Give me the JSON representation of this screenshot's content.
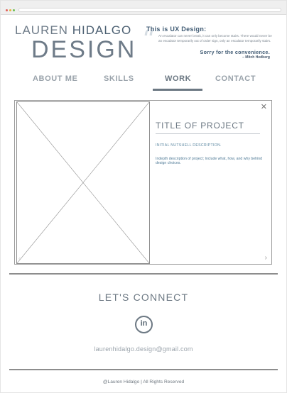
{
  "logo": {
    "first_name": "LAUREN",
    "last_name": "HIDALGO",
    "word": "DESIGN"
  },
  "quote": {
    "title": "This is UX Design:",
    "body": "An escalator can never break, it can only become stairs. There would never be an escalator temporarily out of order sign, only an escalator temporarily stairs.",
    "sorry": "Sorry for the convenience.",
    "author": "– Mitch Hedberg"
  },
  "nav": {
    "items": [
      {
        "label": "ABOUT ME"
      },
      {
        "label": "SKILLS"
      },
      {
        "label": "WORK"
      },
      {
        "label": "CONTACT"
      }
    ],
    "active": "WORK"
  },
  "project": {
    "title": "TITLE OF PROJECT",
    "nutshell": "INITIAL NUTSHELL DESCRIPTION.",
    "description": "Indepth description of project; Include what, how, and why behind design choices."
  },
  "connect": {
    "heading": "LET'S CONNECT",
    "linkedin": "in",
    "email": "laurenhidalgo.design@gmail.com"
  },
  "footer": {
    "text": "@Lauren Hidalgo | All Rights Reserved"
  },
  "icons": {
    "close": "close-icon",
    "prev": "chevron-left-icon",
    "next": "chevron-right-icon",
    "social": "linkedin-icon"
  },
  "colors": {
    "accent": "#6c7883",
    "quote_heading": "#3f5a73",
    "link_blue": "#4f7a96"
  }
}
